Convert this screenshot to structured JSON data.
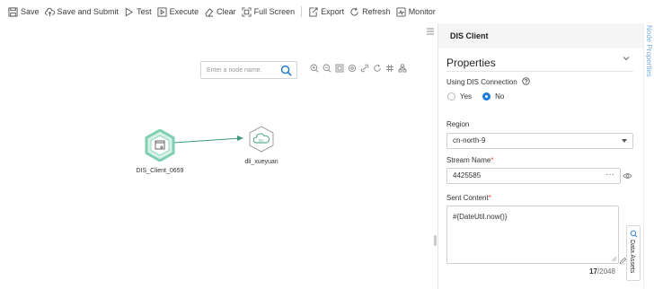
{
  "toolbar": {
    "save": "Save",
    "save_submit": "Save and Submit",
    "test": "Test",
    "execute": "Execute",
    "clear": "Clear",
    "full_screen": "Full Screen",
    "export": "Export",
    "refresh": "Refresh",
    "monitor": "Monitor"
  },
  "canvas": {
    "search_placeholder": "Enter a node name.",
    "nodes": [
      {
        "label": "DIS_Client_0659",
        "type": "dis-client"
      },
      {
        "label": "dli_xueyuan",
        "type": "dli"
      }
    ],
    "tools": [
      "zoom-in-icon",
      "zoom-out-icon",
      "fit-icon",
      "settings-icon",
      "link-icon",
      "refresh-icon",
      "grid-icon",
      "layout-icon"
    ]
  },
  "panel": {
    "title": "DIS Client",
    "section": "Properties",
    "using_dis_label": "Using DIS Connection",
    "yes": "Yes",
    "no": "No",
    "selected_connection": "No",
    "region_label": "Region",
    "region_value": "cn-north-9",
    "stream_label": "Stream Name",
    "stream_value": "4425585",
    "stream_more": "···",
    "content_label": "Sent Content",
    "content_value": "#{DateUtil.now()}",
    "counter_current": "17",
    "counter_max": "/2048",
    "required_mark": "*"
  },
  "side": {
    "node_properties": "Node Properties",
    "data_assets": "Data Assets"
  },
  "colors": {
    "accent": "#1e7bd9",
    "node_green": "#7fcfb0",
    "node_fill": "#d8f1e8",
    "edge": "#3c9a7a"
  }
}
